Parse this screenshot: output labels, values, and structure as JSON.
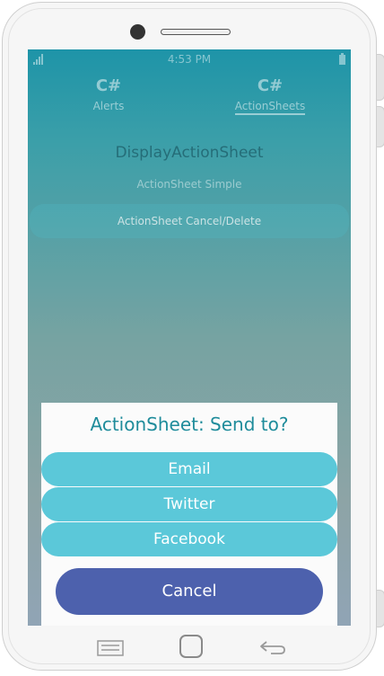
{
  "statusbar": {
    "time": "4:53 PM"
  },
  "tabs": [
    {
      "glyph": "C#",
      "label": "Alerts"
    },
    {
      "glyph": "C#",
      "label": "ActionSheets"
    }
  ],
  "page": {
    "heading": "DisplayActionSheet",
    "simple_button": "ActionSheet Simple",
    "cancel_delete_button": "ActionSheet Cancel/Delete"
  },
  "action_sheet": {
    "title": "ActionSheet: Send to?",
    "options": [
      "Email",
      "Twitter",
      "Facebook"
    ],
    "cancel": "Cancel"
  },
  "colors": {
    "option_background": "#5bc8d9",
    "cancel_background": "#4d61ad",
    "title_color": "#1f8c9b"
  },
  "icons": {
    "signal": "signal-icon",
    "battery": "battery-icon",
    "nav_menu": "menu-icon",
    "nav_home": "home-icon",
    "nav_back": "back-icon"
  }
}
